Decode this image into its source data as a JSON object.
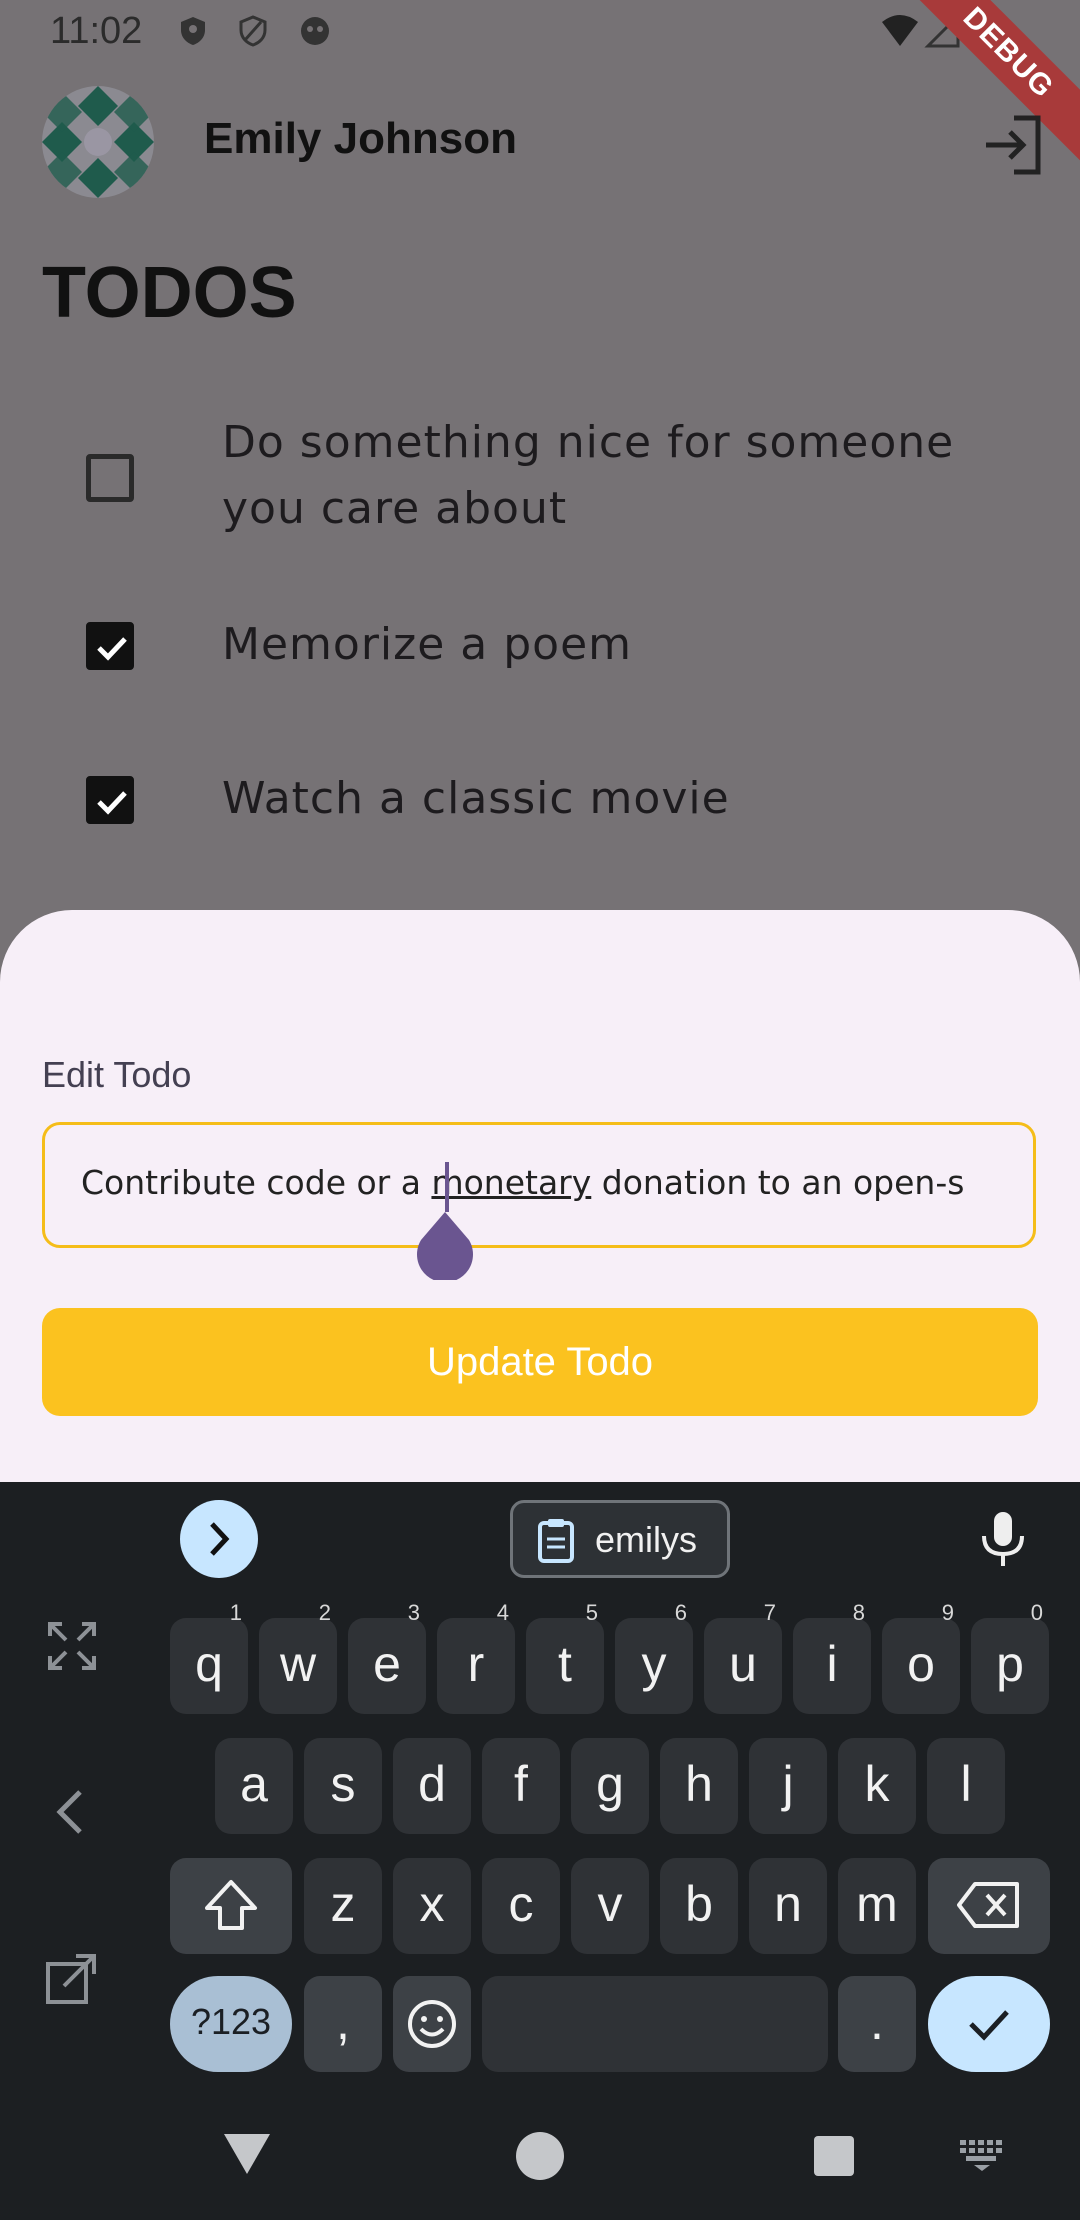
{
  "status": {
    "time": "11:02"
  },
  "debug_label": "DEBUG",
  "header": {
    "user_name": "Emily Johnson"
  },
  "page_title": "TODOS",
  "todos": [
    {
      "text": "Do something nice for someone you care about",
      "done": false
    },
    {
      "text": "Memorize a poem",
      "done": true
    },
    {
      "text": "Watch a classic movie",
      "done": true
    }
  ],
  "sheet": {
    "label": "Edit Todo",
    "input_value_before": "Contribute code or a ",
    "input_value_underlined": "monetary",
    "input_value_after": " donation to an open-s",
    "button_label": "Update Todo"
  },
  "keyboard": {
    "clipboard_chip": "emilys",
    "row1": [
      {
        "k": "q",
        "h": "1"
      },
      {
        "k": "w",
        "h": "2"
      },
      {
        "k": "e",
        "h": "3"
      },
      {
        "k": "r",
        "h": "4"
      },
      {
        "k": "t",
        "h": "5"
      },
      {
        "k": "y",
        "h": "6"
      },
      {
        "k": "u",
        "h": "7"
      },
      {
        "k": "i",
        "h": "8"
      },
      {
        "k": "o",
        "h": "9"
      },
      {
        "k": "p",
        "h": "0"
      }
    ],
    "row2": [
      "a",
      "s",
      "d",
      "f",
      "g",
      "h",
      "j",
      "k",
      "l"
    ],
    "row3": [
      "z",
      "x",
      "c",
      "v",
      "b",
      "n",
      "m"
    ],
    "sym_label": "?123",
    "comma": ",",
    "period": "."
  },
  "colors": {
    "accent": "#fbc21f",
    "sheet_bg": "#f7eff8",
    "cursor": "#6a5590",
    "keyboard_bg": "#1c1f22"
  }
}
